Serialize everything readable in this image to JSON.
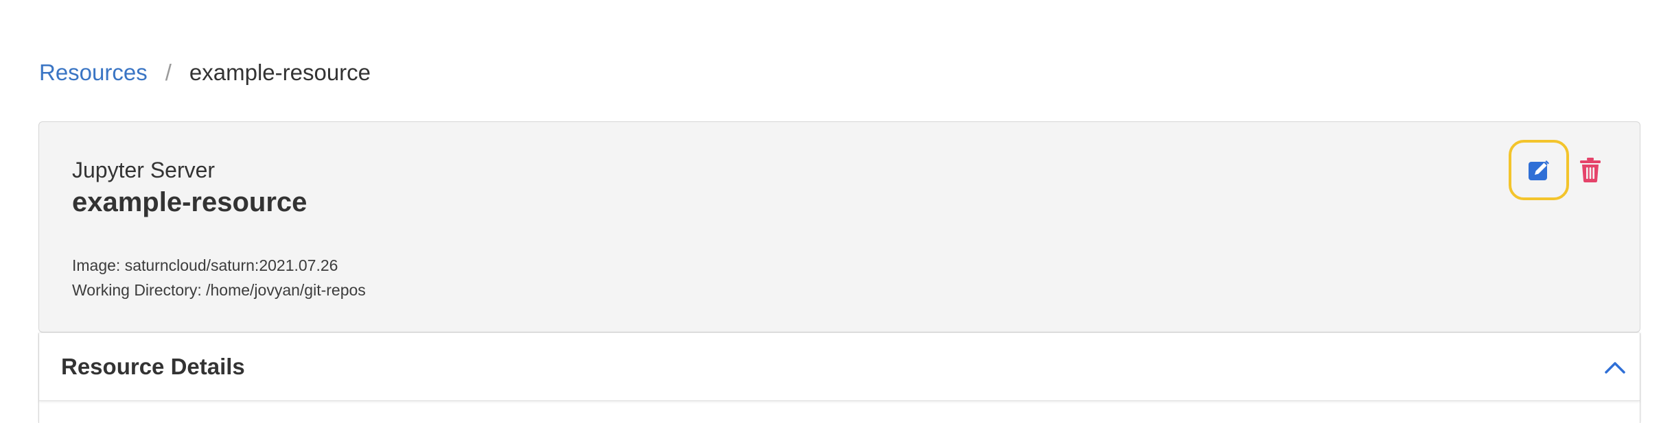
{
  "breadcrumb": {
    "parent_label": "Resources",
    "separator": "/",
    "current_label": "example-resource"
  },
  "resource": {
    "type_label": "Jupyter Server",
    "name": "example-resource",
    "image_line": "Image: saturncloud/saturn:2021.07.26",
    "working_directory_line": "Working Directory: /home/jovyan/git-repos"
  },
  "actions": {
    "edit_icon": "edit-icon",
    "delete_icon": "trash-icon",
    "edit_color": "#2f6fd6",
    "delete_color": "#e5436a",
    "focus_ring_color": "#f3c42c"
  },
  "details_panel": {
    "title": "Resource Details",
    "toggle_icon": "chevron-up-icon",
    "expanded": true
  },
  "colors": {
    "link": "#3a75c4",
    "card_background": "#f4f4f4",
    "text": "#333333"
  }
}
